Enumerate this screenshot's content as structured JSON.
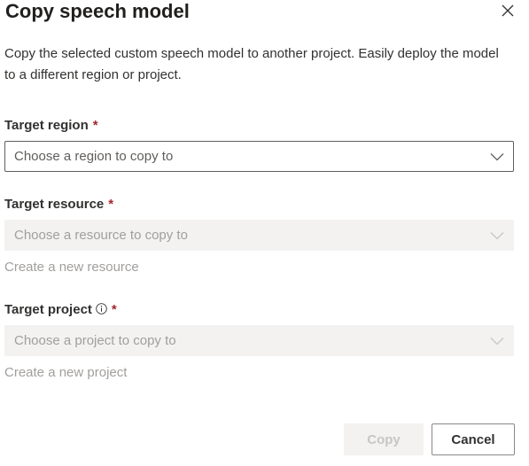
{
  "dialog": {
    "title": "Copy speech model",
    "description": "Copy the selected custom speech model to another project. Easily deploy the model to a different region or project.",
    "close_icon": "close-icon"
  },
  "fields": {
    "region": {
      "label": "Target region",
      "required_mark": "*",
      "placeholder": "Choose a region to copy to",
      "enabled": true
    },
    "resource": {
      "label": "Target resource",
      "required_mark": "*",
      "placeholder": "Choose a resource to copy to",
      "enabled": false,
      "create_link": "Create a new resource"
    },
    "project": {
      "label": "Target project",
      "required_mark": "*",
      "info_icon": "info-icon",
      "placeholder": "Choose a project to copy to",
      "enabled": false,
      "create_link": "Create a new project"
    }
  },
  "buttons": {
    "copy": "Copy",
    "cancel": "Cancel"
  },
  "colors": {
    "required": "#a4262c",
    "disabled_bg": "#f3f2f1",
    "disabled_text": "#a19f9d",
    "border": "#605e5c"
  }
}
